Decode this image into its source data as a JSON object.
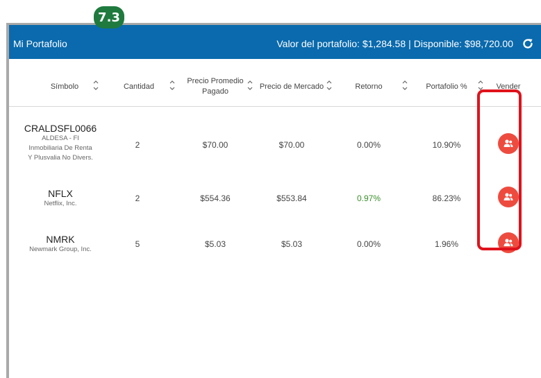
{
  "badge": "7.3",
  "header": {
    "title": "Mi Portafolio",
    "value_label": "Valor del portafolio: $1,284.58",
    "separator": "|",
    "available_label": "Disponible: $98,720.00"
  },
  "columns": {
    "symbol": "Símbolo",
    "quantity": "Cantidad",
    "avg_price_l1": "Precio Promedio",
    "avg_price_l2": "Pagado",
    "market_price": "Precio de Mercado",
    "return": "Retorno",
    "portfolio_pct": "Portafolio %",
    "sell": "Vender"
  },
  "rows": [
    {
      "symbol": "CRALDSFL0066",
      "name_l1": "ALDESA - FI",
      "name_l2": "Inmobiliaria De Renta",
      "name_l3": "Y Plusvalia No Divers.",
      "quantity": "2",
      "avg_price": "$70.00",
      "market_price": "$70.00",
      "return": "0.00%",
      "portfolio_pct": "10.90%"
    },
    {
      "symbol": "NFLX",
      "name_l1": "Netflix, Inc.",
      "quantity": "2",
      "avg_price": "$554.36",
      "market_price": "$553.84",
      "return": "0.97%",
      "portfolio_pct": "86.23%"
    },
    {
      "symbol": "NMRK",
      "name_l1": "Newmark Group, Inc.",
      "quantity": "5",
      "avg_price": "$5.03",
      "market_price": "$5.03",
      "return": "0.00%",
      "portfolio_pct": "1.96%"
    }
  ],
  "colors": {
    "header_bg": "#0a6aad",
    "sell_button": "#ee4b3f",
    "positive_return": "#3a8f2b",
    "badge_bg": "#1f7a3e",
    "highlight_border": "#e0121b"
  },
  "icons": {
    "refresh": "refresh-icon",
    "sort": "sort-arrows-icon",
    "sell": "users-icon"
  }
}
